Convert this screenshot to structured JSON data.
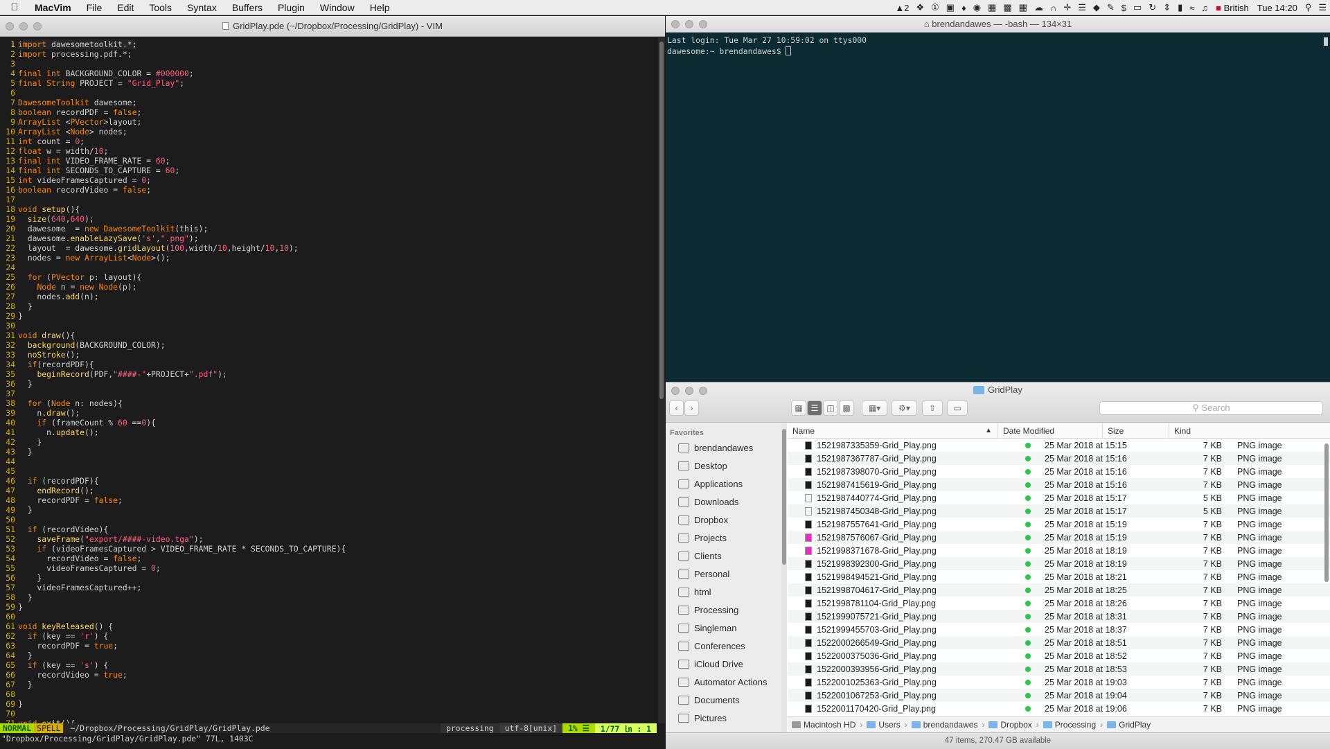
{
  "menubar": {
    "app_name": "MacVim",
    "menus": [
      "File",
      "Edit",
      "Tools",
      "Syntax",
      "Buffers",
      "Plugin",
      "Window",
      "Help"
    ],
    "status_icons": [
      "adobe-icon",
      "dropbox-icon",
      "1password-icon",
      "app-icon",
      "flame-icon",
      "eye-icon",
      "calendar-icon",
      "evernote-icon",
      "grid-icon",
      "cloud-icon",
      "arc-icon",
      "move-icon",
      "list-icon",
      "bucket-icon",
      "pen-icon",
      "dollar-icon",
      "airplay-icon",
      "history-icon",
      "network-icon",
      "battery-icon",
      "wifi-icon",
      "volume-icon"
    ],
    "adobe_count": "2",
    "input_source": "British",
    "clock": "Tue 14:20"
  },
  "vim": {
    "title": "GridPlay.pde (~/Dropbox/Processing/GridPlay) - VIM",
    "lines": [
      {
        "n": "1",
        "t": "import dawesometoolkit.*;"
      },
      {
        "n": "2",
        "t": "import processing.pdf.*;"
      },
      {
        "n": "3",
        "t": ""
      },
      {
        "n": "4",
        "t": "final int BACKGROUND_COLOR = #000000;"
      },
      {
        "n": "5",
        "t": "final String PROJECT = \"Grid_Play\";"
      },
      {
        "n": "6",
        "t": ""
      },
      {
        "n": "7",
        "t": "DawesomeToolkit dawesome;"
      },
      {
        "n": "8",
        "t": "boolean recordPDF = false;"
      },
      {
        "n": "9",
        "t": "ArrayList <PVector>layout;"
      },
      {
        "n": "10",
        "t": "ArrayList <Node> nodes;"
      },
      {
        "n": "11",
        "t": "int count = 0;"
      },
      {
        "n": "12",
        "t": "float w = width/10;"
      },
      {
        "n": "13",
        "t": "final int VIDEO_FRAME_RATE = 60;"
      },
      {
        "n": "14",
        "t": "final int SECONDS_TO_CAPTURE = 60;"
      },
      {
        "n": "15",
        "t": "int videoFramesCaptured = 0;"
      },
      {
        "n": "16",
        "t": "boolean recordVideo = false;"
      },
      {
        "n": "17",
        "t": ""
      },
      {
        "n": "18",
        "t": "void setup(){"
      },
      {
        "n": "19",
        "t": "  size(640,640);"
      },
      {
        "n": "20",
        "t": "  dawesome  = new DawesomeToolkit(this);"
      },
      {
        "n": "21",
        "t": "  dawesome.enableLazySave('s',\".png\");"
      },
      {
        "n": "22",
        "t": "  layout  = dawesome.gridLayout(100,width/10,height/10,10);"
      },
      {
        "n": "23",
        "t": "  nodes = new ArrayList<Node>();"
      },
      {
        "n": "24",
        "t": ""
      },
      {
        "n": "25",
        "t": "  for (PVector p: layout){"
      },
      {
        "n": "26",
        "t": "    Node n = new Node(p);"
      },
      {
        "n": "27",
        "t": "    nodes.add(n);"
      },
      {
        "n": "28",
        "t": "  }"
      },
      {
        "n": "29",
        "t": "}"
      },
      {
        "n": "30",
        "t": ""
      },
      {
        "n": "31",
        "t": "void draw(){"
      },
      {
        "n": "32",
        "t": "  background(BACKGROUND_COLOR);"
      },
      {
        "n": "33",
        "t": "  noStroke();"
      },
      {
        "n": "34",
        "t": "  if(recordPDF){"
      },
      {
        "n": "35",
        "t": "    beginRecord(PDF,\"####-\"+PROJECT+\".pdf\");"
      },
      {
        "n": "36",
        "t": "  }"
      },
      {
        "n": "37",
        "t": ""
      },
      {
        "n": "38",
        "t": "  for (Node n: nodes){"
      },
      {
        "n": "39",
        "t": "    n.draw();"
      },
      {
        "n": "40",
        "t": "    if (frameCount % 60 ==0){"
      },
      {
        "n": "41",
        "t": "      n.update();"
      },
      {
        "n": "42",
        "t": "    }"
      },
      {
        "n": "43",
        "t": "  }"
      },
      {
        "n": "44",
        "t": ""
      },
      {
        "n": "45",
        "t": ""
      },
      {
        "n": "46",
        "t": "  if (recordPDF){"
      },
      {
        "n": "47",
        "t": "    endRecord();"
      },
      {
        "n": "48",
        "t": "    recordPDF = false;"
      },
      {
        "n": "49",
        "t": "  }"
      },
      {
        "n": "50",
        "t": ""
      },
      {
        "n": "51",
        "t": "  if (recordVideo){"
      },
      {
        "n": "52",
        "t": "    saveFrame(\"export/####-video.tga\");"
      },
      {
        "n": "53",
        "t": "    if (videoFramesCaptured > VIDEO_FRAME_RATE * SECONDS_TO_CAPTURE){"
      },
      {
        "n": "54",
        "t": "      recordVideo = false;"
      },
      {
        "n": "55",
        "t": "      videoFramesCaptured = 0;"
      },
      {
        "n": "56",
        "t": "    }"
      },
      {
        "n": "57",
        "t": "    videoFramesCaptured++;"
      },
      {
        "n": "58",
        "t": "  }"
      },
      {
        "n": "59",
        "t": "}"
      },
      {
        "n": "60",
        "t": ""
      },
      {
        "n": "61",
        "t": "void keyReleased() {"
      },
      {
        "n": "62",
        "t": "  if (key == 'r') {"
      },
      {
        "n": "63",
        "t": "    recordPDF = true;"
      },
      {
        "n": "64",
        "t": "  }"
      },
      {
        "n": "65",
        "t": "  if (key == 's') {"
      },
      {
        "n": "66",
        "t": "    recordVideo = true;"
      },
      {
        "n": "67",
        "t": "  }"
      },
      {
        "n": "68",
        "t": ""
      },
      {
        "n": "69",
        "t": "}"
      },
      {
        "n": "70",
        "t": ""
      },
      {
        "n": "71",
        "t": "void exit(){"
      }
    ],
    "status": {
      "mode": "NORMAL",
      "spell": "SPELL",
      "path": "~/Dropbox/Processing/GridPlay/GridPlay.pde",
      "filetype": "processing",
      "encoding": "utf-8[unix]",
      "percent": "1% ☰",
      "position": "1/77 ㏑ : 1"
    },
    "cmdline": "\"Dropbox/Processing/GridPlay/GridPlay.pde\" 77L, 1403C"
  },
  "terminal": {
    "title": "brendandawes — -bash — 134×31",
    "lines": [
      "Last login: Tue Mar 27 10:59:02 on ttys000",
      "dawesome:~ brendandawes$ "
    ]
  },
  "finder": {
    "title": "GridPlay",
    "search_placeholder": "Search",
    "sidebar_heading": "Favorites",
    "sidebar_items": [
      {
        "label": "brendandawes",
        "icon": "home-icon"
      },
      {
        "label": "Desktop",
        "icon": "desktop-icon"
      },
      {
        "label": "Applications",
        "icon": "applications-icon"
      },
      {
        "label": "Downloads",
        "icon": "downloads-icon"
      },
      {
        "label": "Dropbox",
        "icon": "dropbox-icon"
      },
      {
        "label": "Projects",
        "icon": "folder-icon"
      },
      {
        "label": "Clients",
        "icon": "folder-icon"
      },
      {
        "label": "Personal",
        "icon": "folder-icon"
      },
      {
        "label": "html",
        "icon": "folder-icon"
      },
      {
        "label": "Processing",
        "icon": "folder-icon"
      },
      {
        "label": "Singleman",
        "icon": "folder-icon"
      },
      {
        "label": "Conferences",
        "icon": "folder-icon"
      },
      {
        "label": "iCloud Drive",
        "icon": "cloud-icon"
      },
      {
        "label": "Automator Actions",
        "icon": "folder-icon"
      },
      {
        "label": "Documents",
        "icon": "documents-icon"
      },
      {
        "label": "Pictures",
        "icon": "pictures-icon"
      }
    ],
    "columns": {
      "name": "Name",
      "date": "Date Modified",
      "size": "Size",
      "kind": "Kind"
    },
    "files": [
      {
        "name": "1521987335359-Grid_Play.png",
        "date": "25 Mar 2018 at 15:15",
        "size": "7 KB",
        "kind": "PNG image",
        "thumb": "#1a1a1a"
      },
      {
        "name": "1521987367787-Grid_Play.png",
        "date": "25 Mar 2018 at 15:16",
        "size": "7 KB",
        "kind": "PNG image",
        "thumb": "#1a1a1a"
      },
      {
        "name": "1521987398070-Grid_Play.png",
        "date": "25 Mar 2018 at 15:16",
        "size": "7 KB",
        "kind": "PNG image",
        "thumb": "#1a1a1a"
      },
      {
        "name": "1521987415619-Grid_Play.png",
        "date": "25 Mar 2018 at 15:16",
        "size": "7 KB",
        "kind": "PNG image",
        "thumb": "#1a1a1a"
      },
      {
        "name": "1521987440774-Grid_Play.png",
        "date": "25 Mar 2018 at 15:17",
        "size": "5 KB",
        "kind": "PNG image",
        "thumb": "#f5f5f5"
      },
      {
        "name": "1521987450348-Grid_Play.png",
        "date": "25 Mar 2018 at 15:17",
        "size": "5 KB",
        "kind": "PNG image",
        "thumb": "#f5f5f5"
      },
      {
        "name": "1521987557641-Grid_Play.png",
        "date": "25 Mar 2018 at 15:19",
        "size": "7 KB",
        "kind": "PNG image",
        "thumb": "#1a1a1a"
      },
      {
        "name": "1521987576067-Grid_Play.png",
        "date": "25 Mar 2018 at 15:19",
        "size": "7 KB",
        "kind": "PNG image",
        "thumb": "#f028c8"
      },
      {
        "name": "1521998371678-Grid_Play.png",
        "date": "25 Mar 2018 at 18:19",
        "size": "7 KB",
        "kind": "PNG image",
        "thumb": "#f028c8"
      },
      {
        "name": "1521998392300-Grid_Play.png",
        "date": "25 Mar 2018 at 18:19",
        "size": "7 KB",
        "kind": "PNG image",
        "thumb": "#1a1a1a"
      },
      {
        "name": "1521998494521-Grid_Play.png",
        "date": "25 Mar 2018 at 18:21",
        "size": "7 KB",
        "kind": "PNG image",
        "thumb": "#1a1a1a"
      },
      {
        "name": "1521998704617-Grid_Play.png",
        "date": "25 Mar 2018 at 18:25",
        "size": "7 KB",
        "kind": "PNG image",
        "thumb": "#1a1a1a"
      },
      {
        "name": "1521998781104-Grid_Play.png",
        "date": "25 Mar 2018 at 18:26",
        "size": "7 KB",
        "kind": "PNG image",
        "thumb": "#1a1a1a"
      },
      {
        "name": "1521999075721-Grid_Play.png",
        "date": "25 Mar 2018 at 18:31",
        "size": "7 KB",
        "kind": "PNG image",
        "thumb": "#1a1a1a"
      },
      {
        "name": "1521999455703-Grid_Play.png",
        "date": "25 Mar 2018 at 18:37",
        "size": "7 KB",
        "kind": "PNG image",
        "thumb": "#1a1a1a"
      },
      {
        "name": "1522000266549-Grid_Play.png",
        "date": "25 Mar 2018 at 18:51",
        "size": "7 KB",
        "kind": "PNG image",
        "thumb": "#1a1a1a"
      },
      {
        "name": "1522000375036-Grid_Play.png",
        "date": "25 Mar 2018 at 18:52",
        "size": "7 KB",
        "kind": "PNG image",
        "thumb": "#1a1a1a"
      },
      {
        "name": "1522000393956-Grid_Play.png",
        "date": "25 Mar 2018 at 18:53",
        "size": "7 KB",
        "kind": "PNG image",
        "thumb": "#1a1a1a"
      },
      {
        "name": "1522001025363-Grid_Play.png",
        "date": "25 Mar 2018 at 19:03",
        "size": "7 KB",
        "kind": "PNG image",
        "thumb": "#1a1a1a"
      },
      {
        "name": "1522001067253-Grid_Play.png",
        "date": "25 Mar 2018 at 19:04",
        "size": "7 KB",
        "kind": "PNG image",
        "thumb": "#1a1a1a"
      },
      {
        "name": "1522001170420-Grid_Play.png",
        "date": "25 Mar 2018 at 19:06",
        "size": "7 KB",
        "kind": "PNG image",
        "thumb": "#1a1a1a"
      }
    ],
    "path": [
      "Macintosh HD",
      "Users",
      "brendandawes",
      "Dropbox",
      "Processing",
      "GridPlay"
    ],
    "status": "47 items, 270.47 GB available"
  }
}
